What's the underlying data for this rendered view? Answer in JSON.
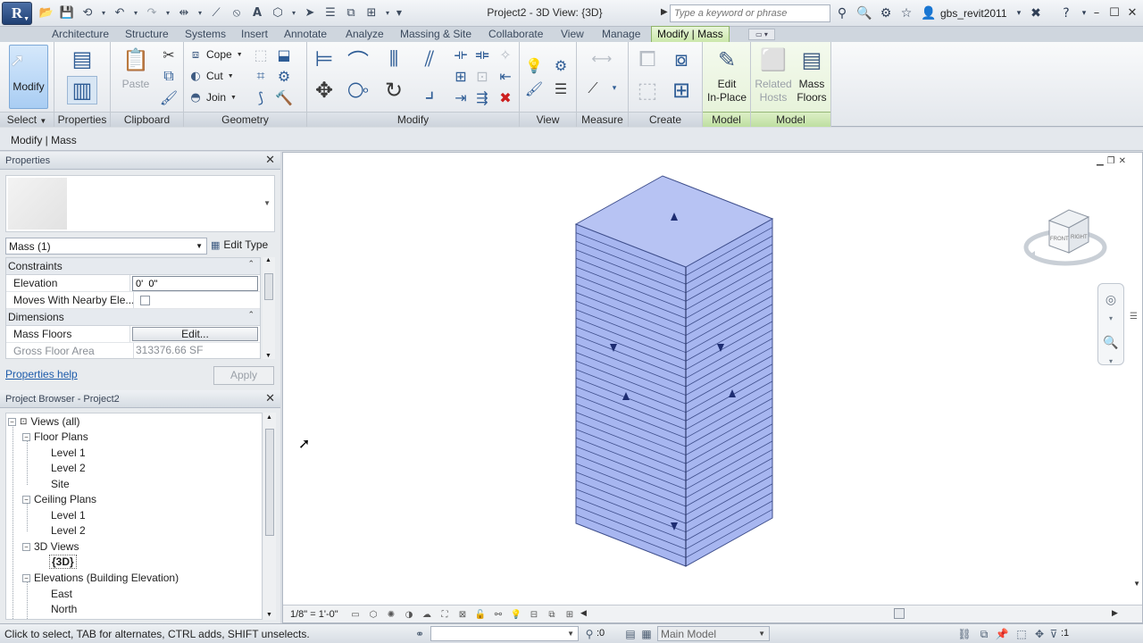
{
  "title_bar": {
    "app_letter": "R",
    "window_title": "Project2 - 3D View: {3D}",
    "search_placeholder": "Type a keyword or phrase",
    "user": "gbs_revit2011"
  },
  "ribbon_tabs": [
    "Architecture",
    "Structure",
    "Systems",
    "Insert",
    "Annotate",
    "Analyze",
    "Massing & Site",
    "Collaborate",
    "View",
    "Manage",
    "Modify | Mass"
  ],
  "ribbon": {
    "modify_label": "Modify",
    "paste_label": "Paste",
    "cope_label": "Cope",
    "cut_label": "Cut",
    "join_label": "Join",
    "edit_in_place_line1": "Edit",
    "edit_in_place_line2": "In-Place",
    "related_hosts_line1": "Related",
    "related_hosts_line2": "Hosts",
    "mass_floors_line1": "Mass",
    "mass_floors_line2": "Floors",
    "panels": {
      "select": "Select",
      "properties": "Properties",
      "clipboard": "Clipboard",
      "geometry": "Geometry",
      "modify": "Modify",
      "view": "View",
      "measure": "Measure",
      "create": "Create",
      "model1": "Model",
      "model2": "Model"
    }
  },
  "options_bar": {
    "context": "Modify | Mass"
  },
  "properties": {
    "header": "Properties",
    "instance_selector": "Mass (1)",
    "edit_type": "Edit Type",
    "groups": {
      "constraints": "Constraints",
      "dimensions": "Dimensions"
    },
    "rows": {
      "elevation_label": "Elevation",
      "elevation_value": "0'  0\"",
      "moves_label": "Moves With Nearby Ele...",
      "mass_floors_label": "Mass Floors",
      "mass_floors_button": "Edit...",
      "gross_area_label": "Gross Floor Area",
      "gross_area_value": "313376.66 SF"
    },
    "help_link": "Properties help",
    "apply": "Apply"
  },
  "project_browser": {
    "header": "Project Browser - Project2",
    "nodes": {
      "views": "Views (all)",
      "floor_plans": "Floor Plans",
      "fp_level1": "Level 1",
      "fp_level2": "Level 2",
      "fp_site": "Site",
      "ceiling_plans": "Ceiling Plans",
      "cp_level1": "Level 1",
      "cp_level2": "Level 2",
      "views_3d": "3D Views",
      "view_3d": "{3D}",
      "elevations": "Elevations (Building Elevation)",
      "el_east": "East",
      "el_north": "North"
    }
  },
  "view": {
    "scale": "1/8\" = 1'-0\"",
    "viewcube_front": "FRONT",
    "viewcube_right": "RIGHT",
    "mass_color": "#a7b6f0",
    "floor_count": 34
  },
  "status_bar": {
    "message": "Click to select, TAB for alternates, CTRL adds, SHIFT unselects.",
    "worksets_count": ":0",
    "model": "Main Model",
    "filter_count": ":1"
  }
}
